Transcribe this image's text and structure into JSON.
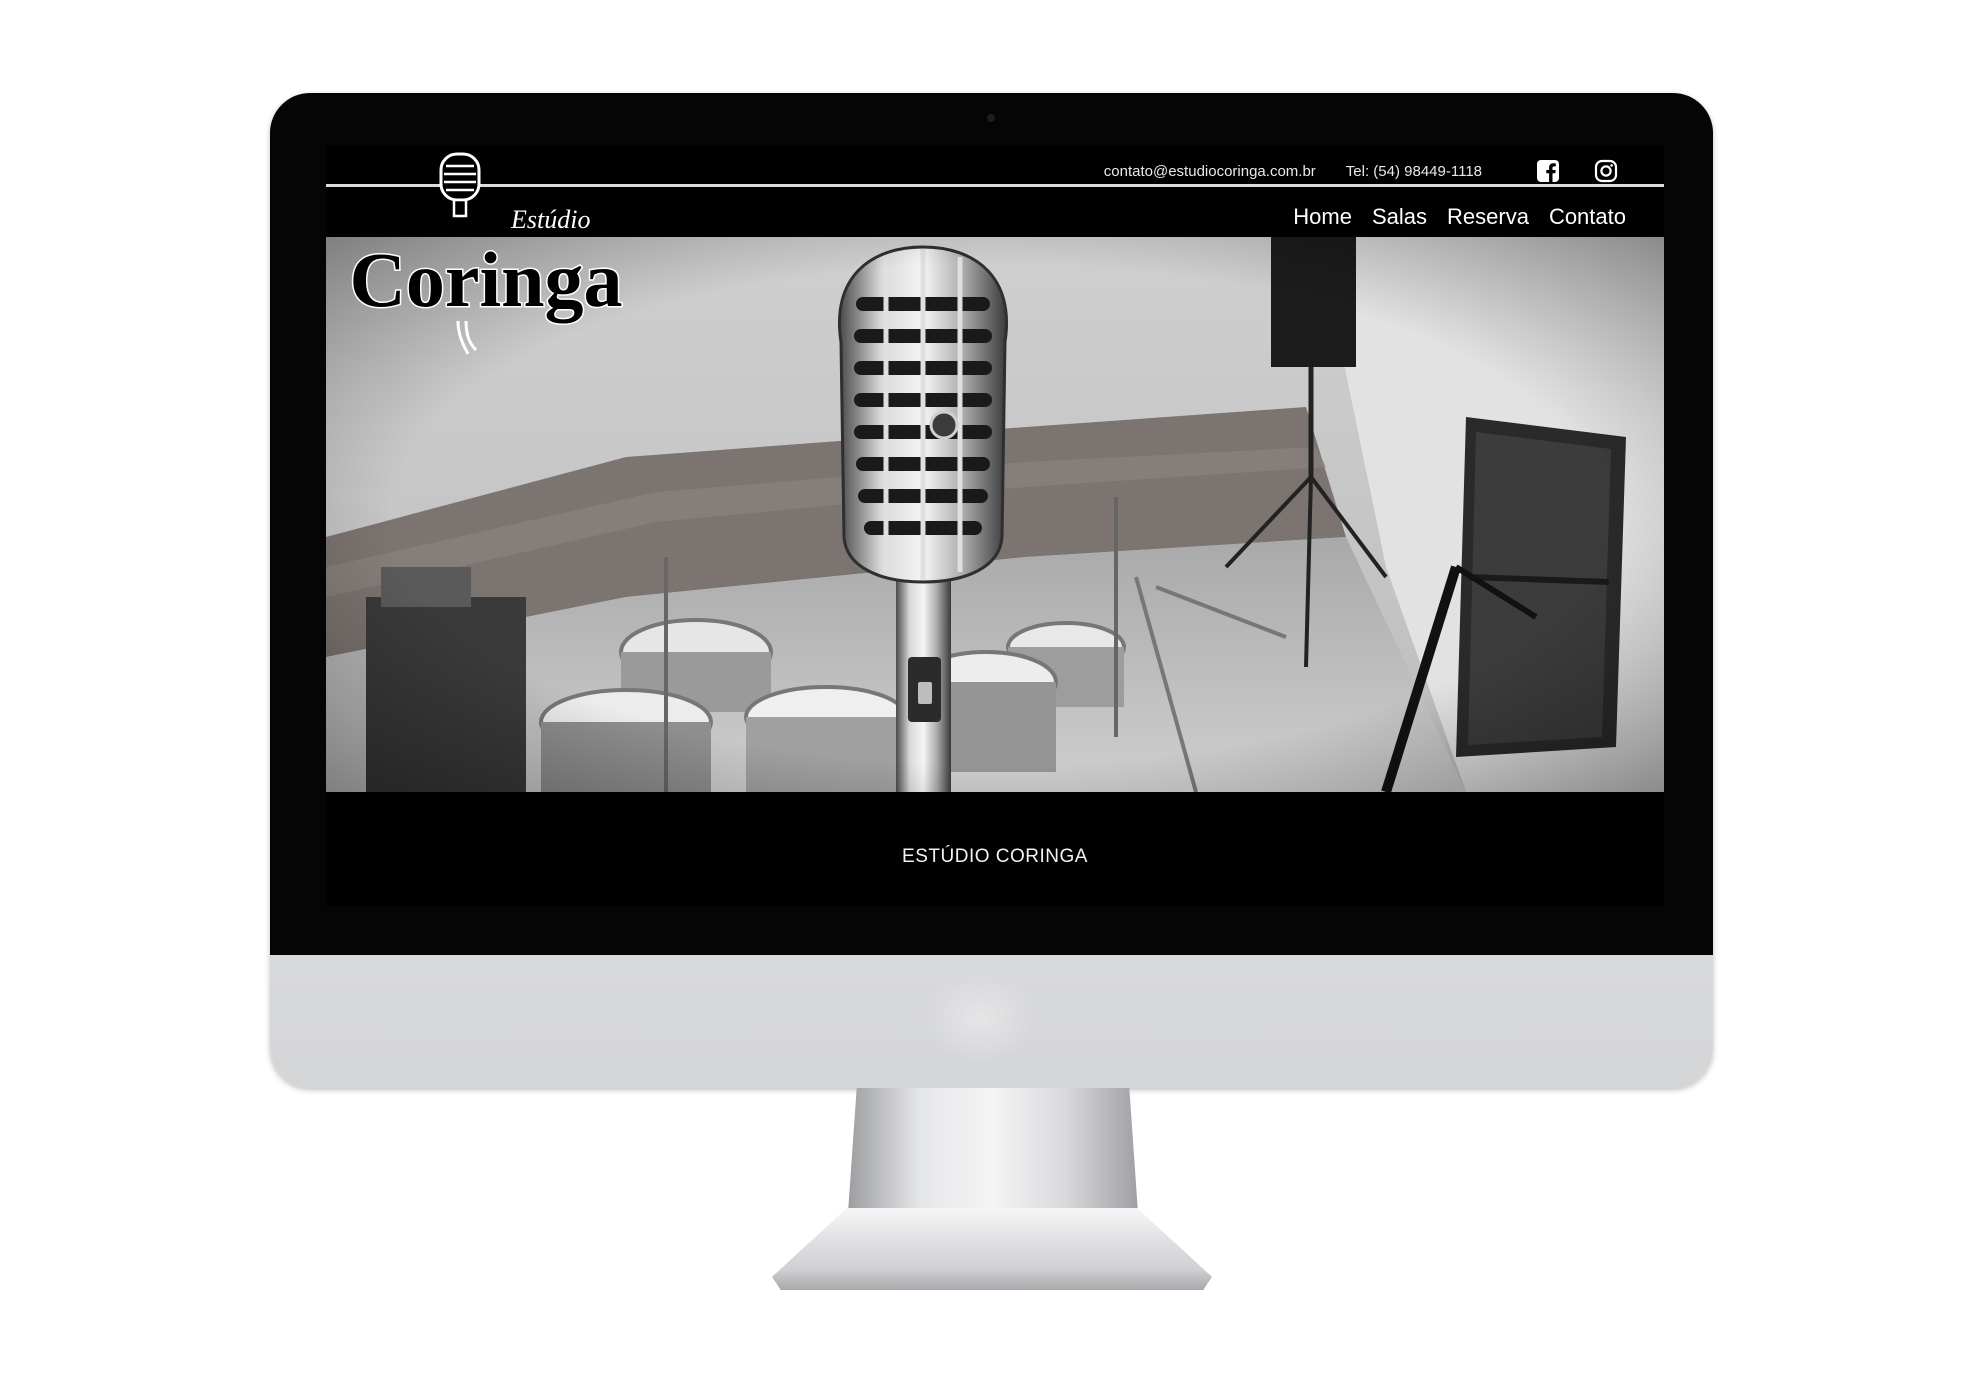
{
  "site": {
    "logo_text_script": "Estúdio",
    "logo_text_main": "Coringa"
  },
  "topbar": {
    "email": "contato@estudiocoringa.com.br",
    "phone": "Tel: (54) 98449-1118",
    "icons": [
      "facebook-icon",
      "instagram-icon"
    ]
  },
  "nav": {
    "items": [
      {
        "label": "Home"
      },
      {
        "label": "Salas"
      },
      {
        "label": "Reserva"
      },
      {
        "label": "Contato"
      }
    ]
  },
  "main": {
    "section_title": "ESTÚDIO CORINGA"
  },
  "colors": {
    "background": "#000000",
    "text": "#ffffff",
    "divider": "#dcdcdc"
  }
}
